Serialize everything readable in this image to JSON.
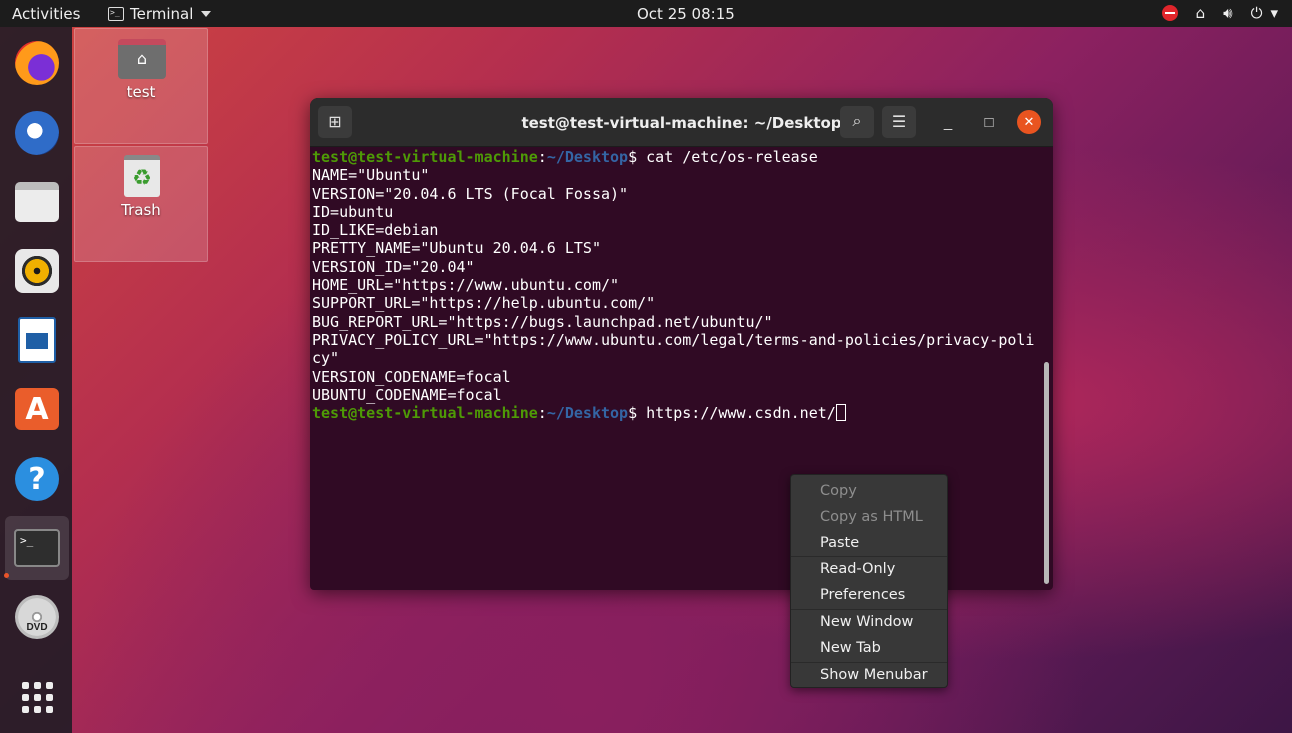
{
  "topbar": {
    "activities": "Activities",
    "app_name": "Terminal",
    "clock": "Oct 25  08:15"
  },
  "desktop": {
    "icons": [
      {
        "label": "test",
        "icon": "home-folder-icon"
      },
      {
        "label": "Trash",
        "icon": "trash-icon"
      }
    ]
  },
  "dock": {
    "items": [
      "firefox-icon",
      "thunderbird-icon",
      "files-icon",
      "rhythmbox-icon",
      "libreoffice-writer-icon",
      "ubuntu-software-icon",
      "help-icon",
      "terminal-icon",
      "dvd-icon",
      "show-applications-icon"
    ],
    "dvd_label": "DVD",
    "active": "terminal-icon"
  },
  "terminal": {
    "title": "test@test-virtual-machine: ~/Desktop",
    "prompt_user": "test@test-virtual-machine",
    "prompt_sep": ":",
    "prompt_path": "~/Desktop",
    "prompt_dollar": "$ ",
    "command1": "cat /etc/os-release",
    "output": [
      "NAME=\"Ubuntu\"",
      "VERSION=\"20.04.6 LTS (Focal Fossa)\"",
      "ID=ubuntu",
      "ID_LIKE=debian",
      "PRETTY_NAME=\"Ubuntu 20.04.6 LTS\"",
      "VERSION_ID=\"20.04\"",
      "HOME_URL=\"https://www.ubuntu.com/\"",
      "SUPPORT_URL=\"https://help.ubuntu.com/\"",
      "BUG_REPORT_URL=\"https://bugs.launchpad.net/ubuntu/\"",
      "PRIVACY_POLICY_URL=\"https://www.ubuntu.com/legal/terms-and-policies/privacy-poli",
      "cy\"",
      "VERSION_CODENAME=focal",
      "UBUNTU_CODENAME=focal"
    ],
    "command2": "https://www.csdn.net/"
  },
  "context_menu": {
    "items": [
      {
        "label": "Copy",
        "enabled": false
      },
      {
        "label": "Copy as HTML",
        "enabled": false
      },
      {
        "label": "Paste",
        "enabled": true
      },
      {
        "label": "Read-Only",
        "enabled": true
      },
      {
        "label": "Preferences",
        "enabled": true
      },
      {
        "label": "New Window",
        "enabled": true
      },
      {
        "label": "New Tab",
        "enabled": true
      },
      {
        "label": "Show Menubar",
        "enabled": true
      }
    ]
  },
  "colors": {
    "terminal_bg": "#300a24",
    "prompt_user": "#4e9a06",
    "prompt_path": "#3465a4",
    "close_button": "#e95420"
  }
}
